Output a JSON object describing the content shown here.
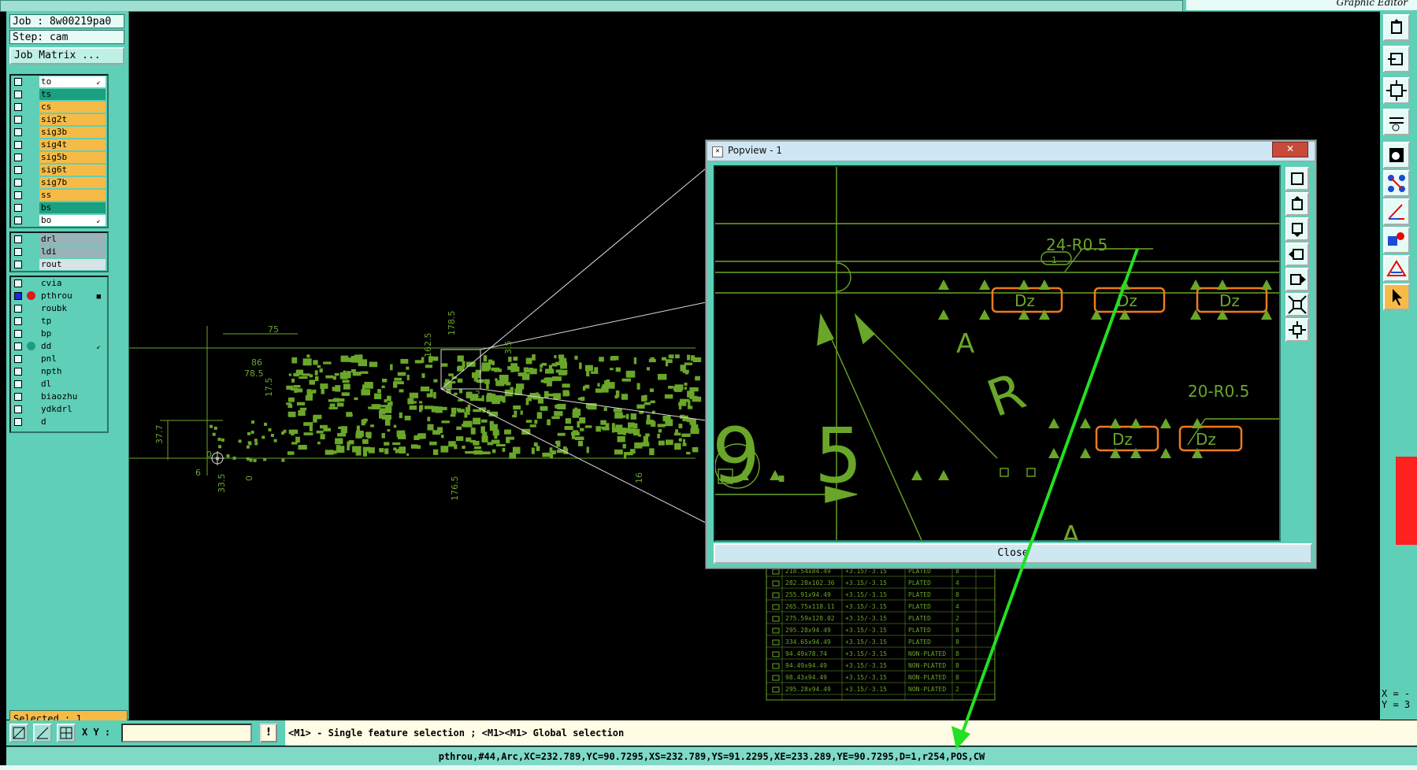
{
  "app": {
    "title": "Graphic Editor"
  },
  "job": {
    "job_line": "Job : 8w00219pa0",
    "step_line": "Step: cam",
    "matrix_button": "Job Matrix ..."
  },
  "layers": {
    "board": [
      {
        "name": "to",
        "color": "#ffffff",
        "mark": "⇙"
      },
      {
        "name": "ts",
        "color": "#1aa07f",
        "mark": ""
      },
      {
        "name": "cs",
        "color": "#f6bb47",
        "mark": ""
      },
      {
        "name": "sig2t",
        "color": "#f6bb47",
        "mark": ""
      },
      {
        "name": "sig3b",
        "color": "#f6bb47",
        "mark": ""
      },
      {
        "name": "sig4t",
        "color": "#f6bb47",
        "mark": ""
      },
      {
        "name": "sig5b",
        "color": "#f6bb47",
        "mark": ""
      },
      {
        "name": "sig6t",
        "color": "#f6bb47",
        "mark": ""
      },
      {
        "name": "sig7b",
        "color": "#f6bb47",
        "mark": ""
      },
      {
        "name": "ss",
        "color": "#f6bb47",
        "mark": ""
      },
      {
        "name": "bs",
        "color": "#1aa07f",
        "mark": ""
      },
      {
        "name": "bo",
        "color": "#ffffff",
        "mark": "⇙"
      }
    ],
    "drill": [
      {
        "name": "drl",
        "color": "#9ab3b8",
        "mark": ""
      },
      {
        "name": "ldi",
        "color": "#9ab3b8",
        "mark": ""
      },
      {
        "name": "rout",
        "color": "#d7e3e6",
        "mark": ""
      }
    ],
    "misc": [
      {
        "name": "cvia",
        "color": "#5fcfb7",
        "mark": ""
      },
      {
        "name": "pthrou",
        "color": "#5fcfb7",
        "mark": "■"
      },
      {
        "name": "roubk",
        "color": "#5fcfb7",
        "mark": ""
      },
      {
        "name": "tp",
        "color": "#5fcfb7",
        "mark": ""
      },
      {
        "name": "bp",
        "color": "#5fcfb7",
        "mark": ""
      },
      {
        "name": "dd",
        "color": "#5fcfb7",
        "mark": "⇙"
      },
      {
        "name": "pnl",
        "color": "#5fcfb7",
        "mark": ""
      },
      {
        "name": "npth",
        "color": "#5fcfb7",
        "mark": ""
      },
      {
        "name": "dl",
        "color": "#5fcfb7",
        "mark": ""
      },
      {
        "name": "biaozhu",
        "color": "#5fcfb7",
        "mark": ""
      },
      {
        "name": "ydkdrl",
        "color": "#5fcfb7",
        "mark": ""
      },
      {
        "name": "d",
        "color": "#5fcfb7",
        "mark": ""
      }
    ]
  },
  "selected": "Selected : 1",
  "command_bar": {
    "xy_label": "X Y :",
    "xy_value": "",
    "hint_button": "!",
    "hint": "<M1> - Single feature selection ; <M1><M1> Global selection"
  },
  "status": "pthrou,#44,Arc,XC=232.789,YC=90.7295,XS=232.789,YS=91.2295,XE=233.289,YE=90.7295,D=1,r254,POS,CW",
  "coords": {
    "x": "X = -",
    "y": "Y = 3"
  },
  "popview": {
    "title": "Popview - 1",
    "close_x": "✕",
    "close_button": "Close",
    "labels": [
      "24-R0.5",
      "20-R0.5",
      "Dz",
      "A",
      "R",
      "9",
      ".",
      "5",
      "1"
    ]
  },
  "canvas": {
    "dims": [
      "75",
      "86",
      "78.5",
      "17.5",
      "37.7",
      "0",
      "6",
      "33.5",
      "0",
      "162.5",
      "178.5",
      "3.5",
      "384.5",
      "176.5",
      "16",
      "2"
    ]
  },
  "table": {
    "rows": [
      [
        "218.54x84.49",
        "+3.15/-3.15",
        "PLATED",
        "8"
      ],
      [
        "282.28x102.36",
        "+3.15/-3.15",
        "PLATED",
        "4"
      ],
      [
        "255.91x94.49",
        "+3.15/-3.15",
        "PLATED",
        "8"
      ],
      [
        "265.75x118.11",
        "+3.15/-3.15",
        "PLATED",
        "4"
      ],
      [
        "275.59x128.02",
        "+3.15/-3.15",
        "PLATED",
        "2"
      ],
      [
        "295.28x94.49",
        "+3.15/-3.15",
        "PLATED",
        "8"
      ],
      [
        "334.65x94.49",
        "+3.15/-3.15",
        "PLATED",
        "8"
      ],
      [
        "94.49x78.74",
        "+3.15/-3.15",
        "NON-PLATED",
        "8"
      ],
      [
        "94.49x94.49",
        "+3.15/-3.15",
        "NON-PLATED",
        "8"
      ],
      [
        "98.43x94.49",
        "+3.15/-3.15",
        "NON-PLATED",
        "8"
      ],
      [
        "295.28x94.49",
        "+3.15/-3.15",
        "NON-PLATED",
        "2"
      ]
    ]
  },
  "colors": {
    "panel": "#5fcfb7",
    "cad_green": "#6aa629",
    "arrow": "#22e022",
    "pad_orange": "#f07a1a"
  }
}
